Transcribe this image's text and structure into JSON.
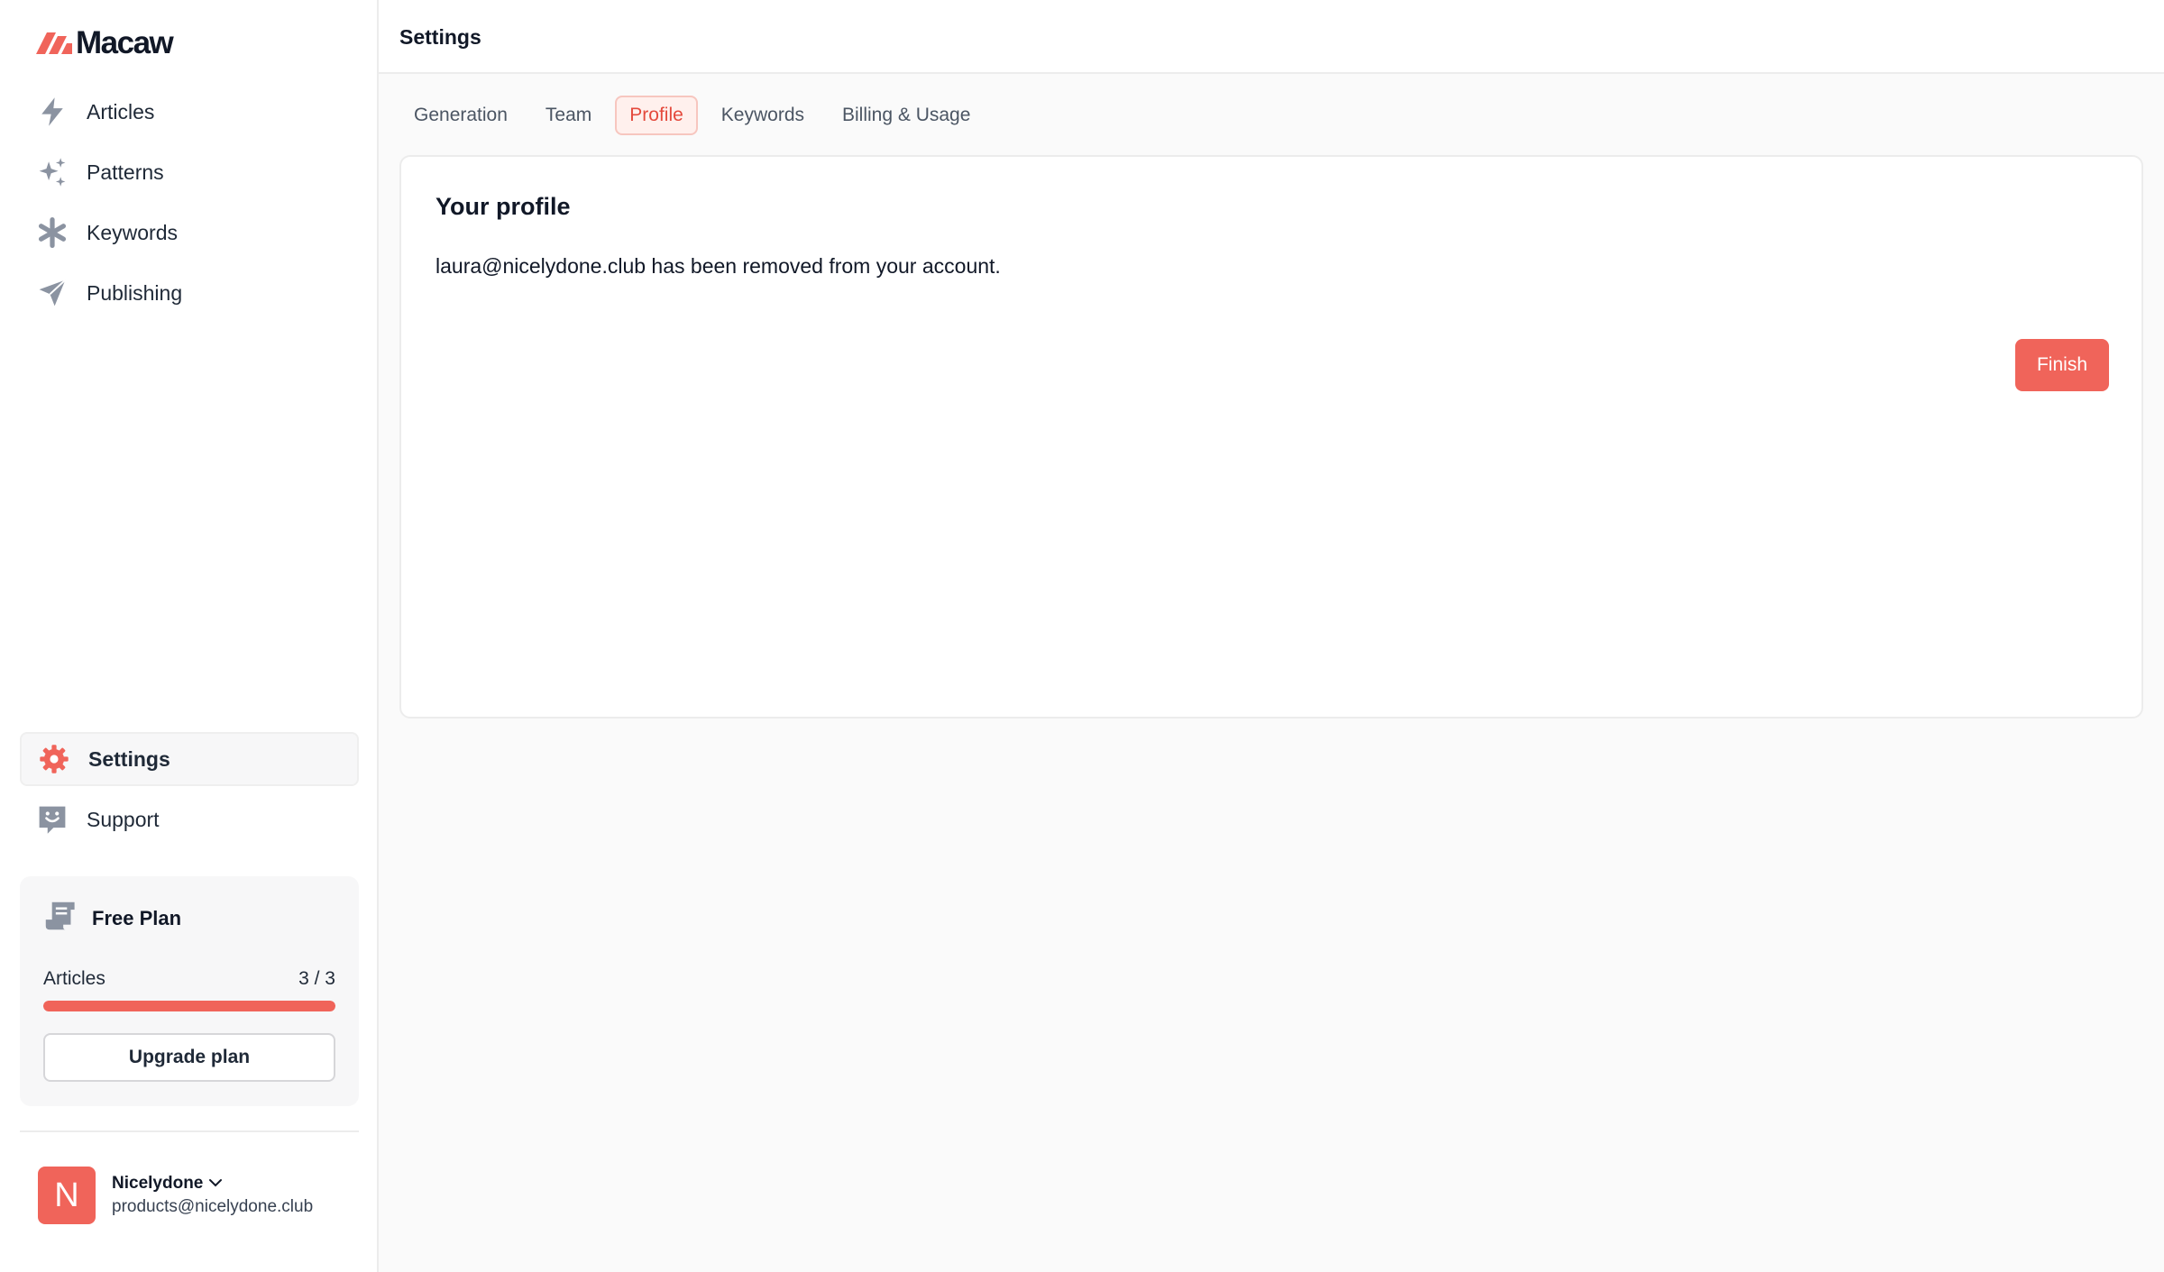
{
  "app": {
    "name": "Macaw"
  },
  "sidebar": {
    "items": [
      {
        "label": "Articles",
        "icon": "bolt-icon"
      },
      {
        "label": "Patterns",
        "icon": "sparkles-icon"
      },
      {
        "label": "Keywords",
        "icon": "asterisk-icon"
      },
      {
        "label": "Publishing",
        "icon": "paper-plane-icon"
      }
    ],
    "bottom_items": [
      {
        "label": "Settings",
        "icon": "gear-icon",
        "active": true
      },
      {
        "label": "Support",
        "icon": "smile-chat-icon"
      }
    ]
  },
  "plan": {
    "name": "Free Plan",
    "metric_label": "Articles",
    "metric_value": "3 / 3",
    "progress_fraction": 1.0,
    "upgrade_label": "Upgrade plan"
  },
  "user": {
    "initial": "N",
    "name": "Nicelydone",
    "email": "products@nicelydone.club"
  },
  "header": {
    "title": "Settings"
  },
  "tabs": [
    {
      "label": "Generation",
      "active": false
    },
    {
      "label": "Team",
      "active": false
    },
    {
      "label": "Profile",
      "active": true
    },
    {
      "label": "Keywords",
      "active": false
    },
    {
      "label": "Billing & Usage",
      "active": false
    }
  ],
  "profile_card": {
    "title": "Your profile",
    "message": "laura@nicelydone.club has been removed from your account.",
    "finish_label": "Finish"
  },
  "colors": {
    "accent": "#f0645a",
    "icon_gray": "#8b93a1",
    "tab_active_text": "#e4493c"
  }
}
